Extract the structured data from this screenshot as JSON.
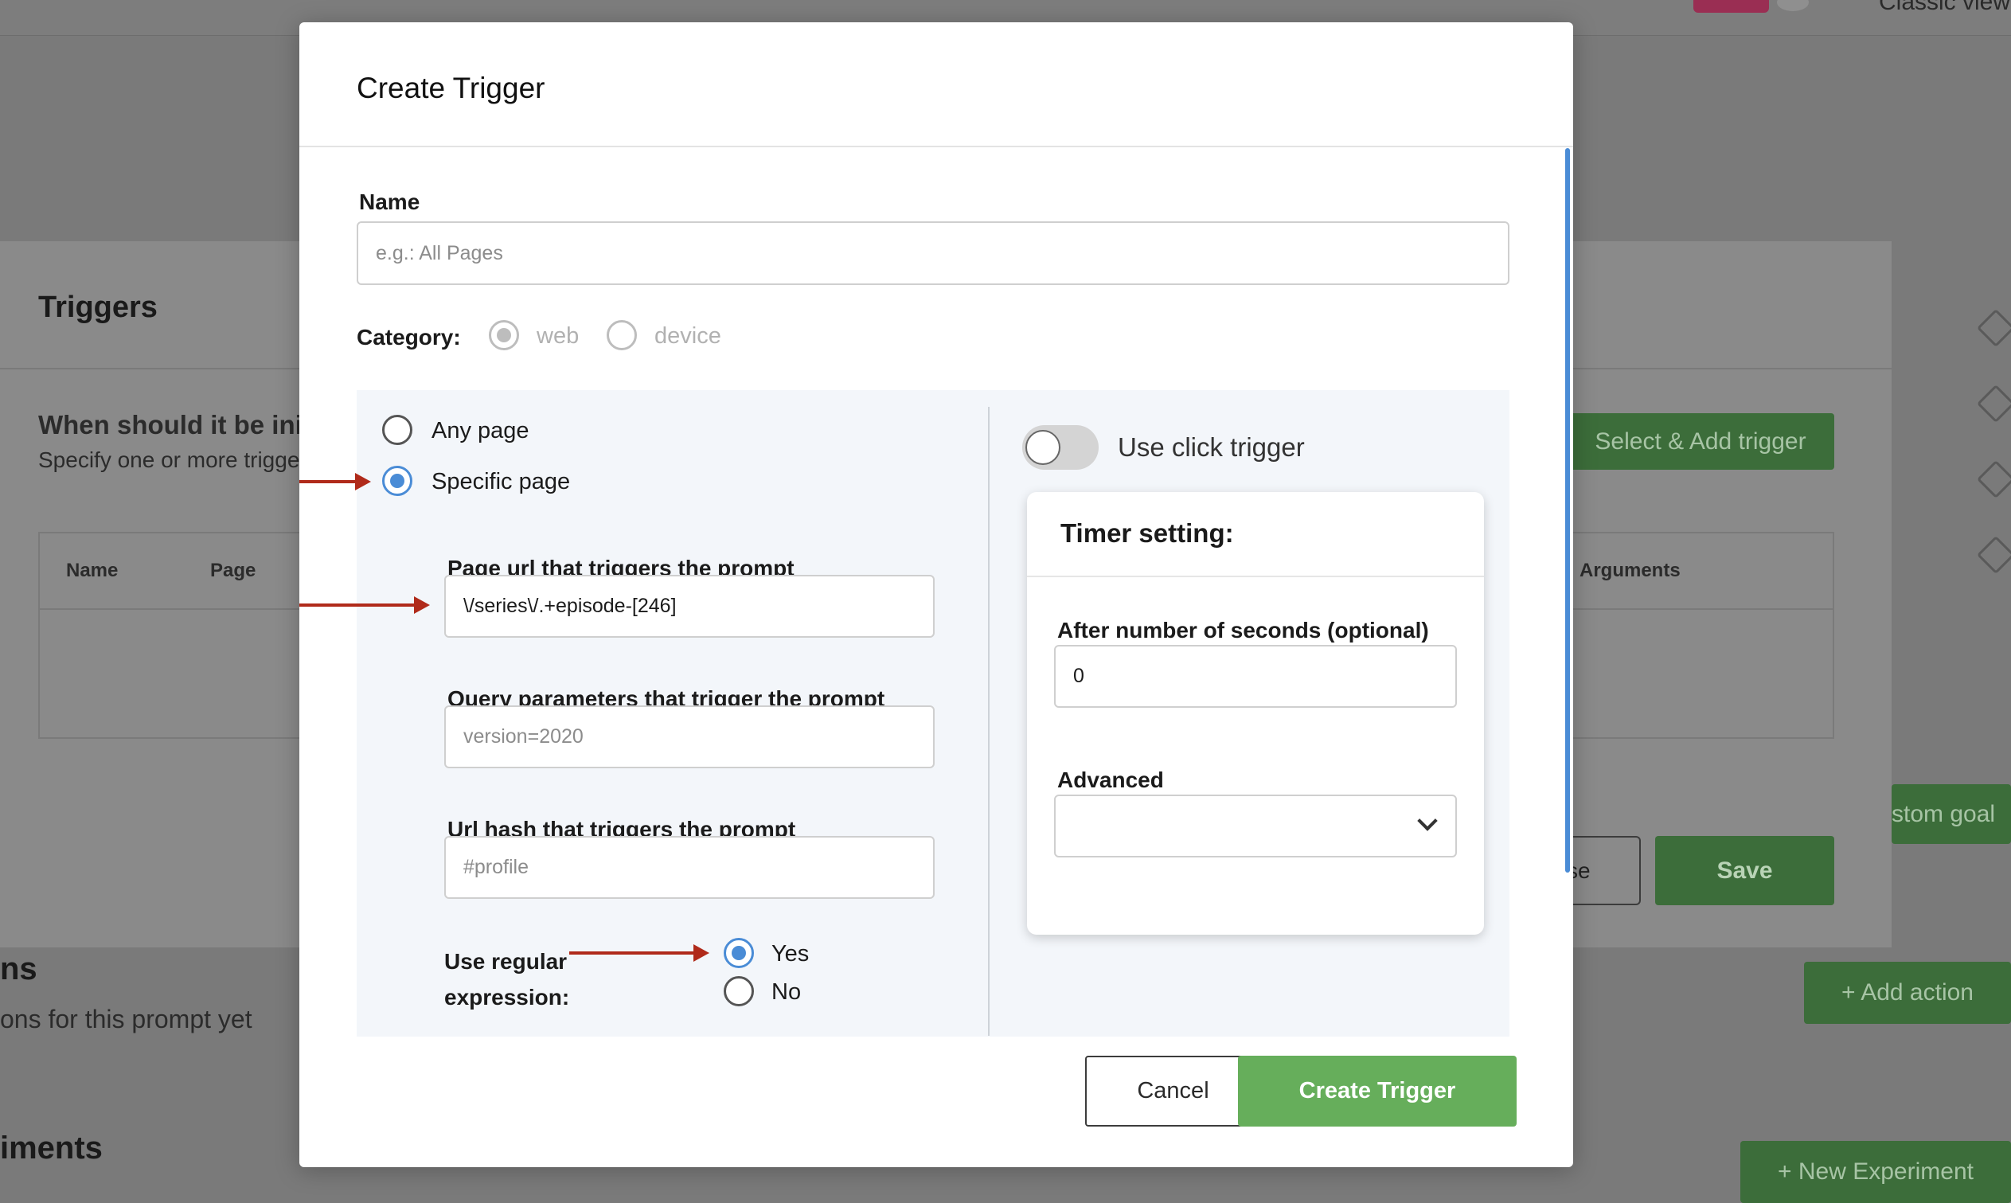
{
  "background": {
    "classic_view": "Classic view",
    "panel_title": "Triggers",
    "when_text": "When should it be init",
    "specify_text": "Specify one or more trigge",
    "table_headers": [
      "Name",
      "Page",
      "Arguments"
    ],
    "select_add_trigger": "Select & Add trigger",
    "custom_goal": "stom goal",
    "close_fragment": "se",
    "save": "Save",
    "actions_title": "ns",
    "actions_sub": "ons for this prompt yet",
    "add_action": "+ Add action",
    "experiments_title": "iments",
    "new_experiment": "+ New Experiment"
  },
  "modal": {
    "title": "Create Trigger",
    "name_label": "Name",
    "name_placeholder": "e.g.: All Pages",
    "category_label": "Category:",
    "category_options": [
      "web",
      "device"
    ],
    "category_selected": "web",
    "page_options": [
      "Any page",
      "Specific page"
    ],
    "page_selected": "Specific page",
    "url_label": "Page url that triggers the prompt",
    "url_value": "\\/series\\/.+episode-[246]",
    "query_label": "Query parameters that trigger the prompt",
    "query_placeholder": "version=2020",
    "hash_label": "Url hash that triggers the prompt",
    "hash_placeholder": "#profile",
    "regex_label_line1": "Use regular",
    "regex_label_line2": "expression:",
    "regex_options": [
      "Yes",
      "No"
    ],
    "regex_selected": "Yes",
    "click_trigger_label": "Use click trigger",
    "click_trigger_on": false,
    "timer_title": "Timer setting:",
    "seconds_label": "After number of seconds (optional)",
    "seconds_value": "0",
    "advanced_label": "Advanced",
    "advanced_value": "",
    "cancel_label": "Cancel",
    "create_label": "Create Trigger"
  },
  "colors": {
    "accent_blue": "#4a8cd6",
    "primary_green": "#66ae5b",
    "annotation_arrow": "#b02a1a"
  }
}
